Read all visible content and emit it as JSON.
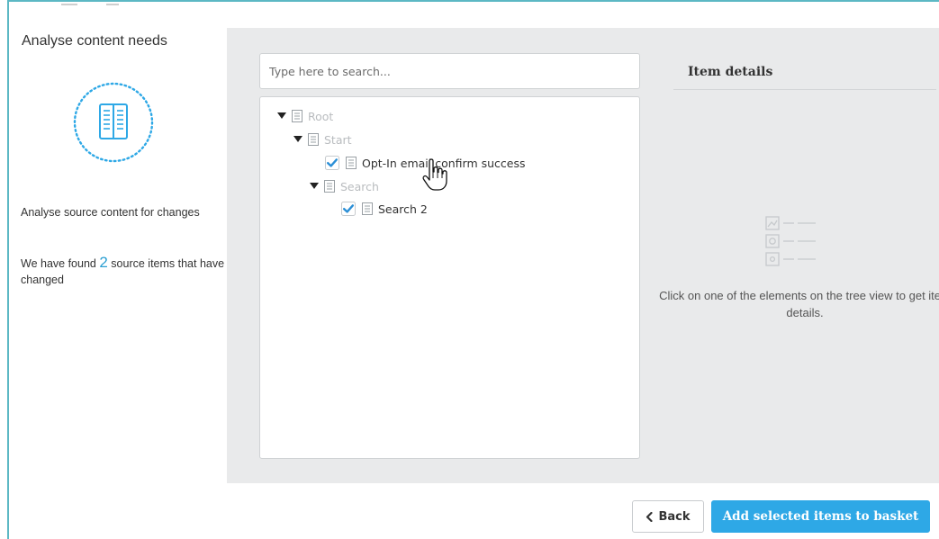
{
  "step": {
    "title": "Analyse content needs",
    "icon": "book-icon",
    "description": "Analyse source content for changes",
    "found_prefix": "We have found",
    "found_count": "2",
    "found_suffix": "source items that have changed"
  },
  "search": {
    "placeholder": "Type here to search..."
  },
  "tree": {
    "root": "Root",
    "start": "Start",
    "opt_in": "Opt-In email confirm success",
    "search_folder": "Search",
    "search2": "Search 2"
  },
  "details": {
    "title": "Item details",
    "empty_message": "Click on one of the elements on the tree view to get item details."
  },
  "buttons": {
    "back": "Back",
    "add": "Add selected items to basket"
  },
  "colors": {
    "accent": "#2ea8e6",
    "frame": "#5cb8c4",
    "count": "#2b9fd2",
    "panel": "#e9eaeb"
  }
}
